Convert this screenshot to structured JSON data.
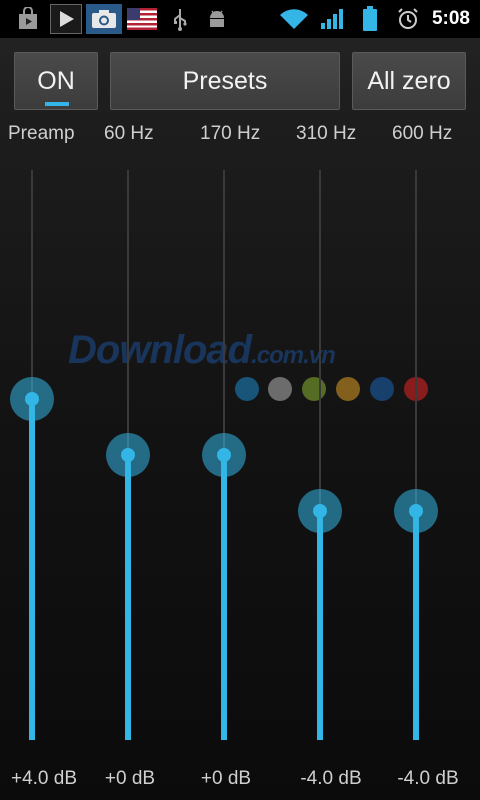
{
  "status_bar": {
    "time": "5:08",
    "icons": [
      "play-store-icon",
      "play-icon",
      "camera-icon",
      "us-flag-icon",
      "usb-icon",
      "android-debug-icon",
      "wifi-icon",
      "signal-icon",
      "battery-icon",
      "alarm-icon"
    ]
  },
  "toolbar": {
    "on_label": "ON",
    "presets_label": "Presets",
    "all_zero_label": "All zero",
    "accent_color": "#33b5e5"
  },
  "bands": [
    {
      "label": "Preamp",
      "db_label": "+4.0 dB",
      "level_db": 4.0
    },
    {
      "label": "60 Hz",
      "db_label": "+0 dB",
      "level_db": 0
    },
    {
      "label": "170 Hz",
      "db_label": "+0 dB",
      "level_db": 0
    },
    {
      "label": "310 Hz",
      "db_label": "-4.0 dB",
      "level_db": -4.0
    },
    {
      "label": "600 Hz",
      "db_label": "-4.0 dB",
      "level_db": -4.0
    }
  ],
  "watermark": {
    "text_main": "Download",
    "text_domain": ".com.vn",
    "dot_colors": [
      "#1a6b9a",
      "#8a8a8a",
      "#6a8a2a",
      "#a87a20",
      "#1a4f8a",
      "#b02020"
    ]
  }
}
